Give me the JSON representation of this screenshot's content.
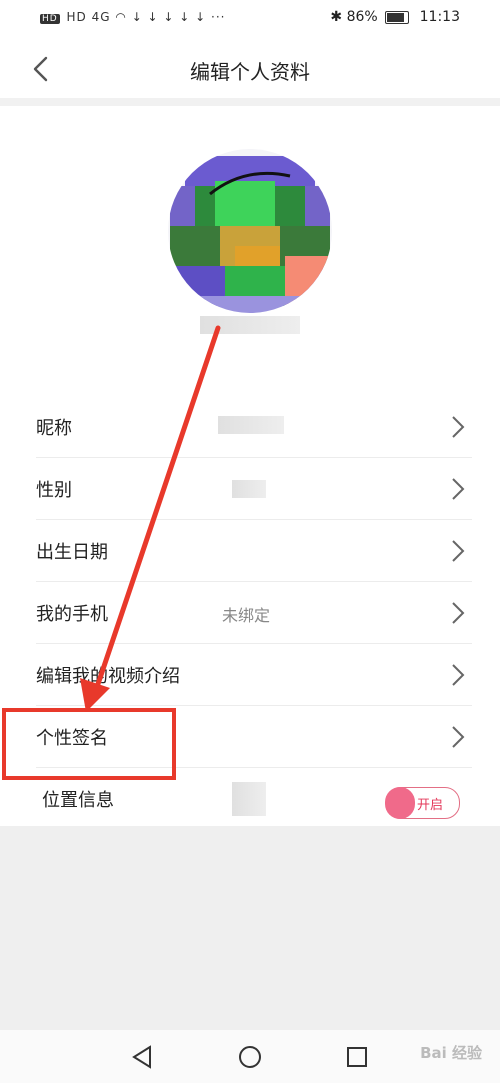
{
  "status_bar": {
    "left_indicators": "HD 4G",
    "battery_percent": "86%",
    "time": "11:13"
  },
  "header": {
    "title": "编辑个人资料",
    "back_icon": "chevron-left-icon"
  },
  "rows": [
    {
      "label": "昵称",
      "value": ""
    },
    {
      "label": "性别",
      "value": ""
    },
    {
      "label": "出生日期",
      "value": ""
    },
    {
      "label": "我的手机",
      "value": "未绑定"
    },
    {
      "label": "编辑我的视频介绍",
      "value": ""
    },
    {
      "label": "个性签名",
      "value": ""
    },
    {
      "label": "位置信息",
      "toggle_label": "开启"
    }
  ],
  "colors": {
    "highlight_box": "#e8392b",
    "toggle_accent": "#f06a8a"
  },
  "watermark": "Bai 经验",
  "nav": {
    "back_icon": "triangle-back-icon",
    "home_icon": "circle-home-icon",
    "recent_icon": "square-recent-icon"
  }
}
